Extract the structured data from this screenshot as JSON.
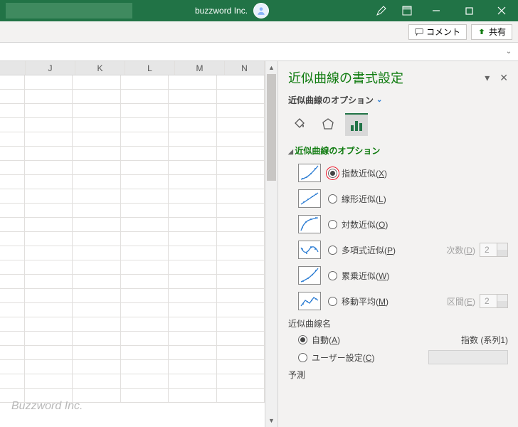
{
  "titlebar": {
    "app_title": "buzzword Inc."
  },
  "ribbon": {
    "comment_label": "コメント",
    "share_label": "共有"
  },
  "grid": {
    "columns": [
      "",
      "J",
      "K",
      "L",
      "M",
      "N"
    ]
  },
  "pane": {
    "title": "近似曲線の書式設定",
    "subtitle": "近似曲線のオプション",
    "section": "近似曲線のオプション",
    "options": {
      "exponential": "指数近似(X)",
      "linear": "線形近似(L)",
      "logarithmic": "対数近似(O)",
      "polynomial": "多項式近似(P)",
      "power": "累乗近似(W)",
      "moving_avg": "移動平均(M)",
      "degree_label": "次数(D)",
      "degree_value": "2",
      "period_label": "区間(E)",
      "period_value": "2"
    },
    "name": {
      "section": "近似曲線名",
      "auto": "自動(A)",
      "custom": "ユーザー設定(C)",
      "auto_value": "指数 (系列1)"
    },
    "forecast": "予測"
  },
  "watermark": "Buzzword Inc."
}
